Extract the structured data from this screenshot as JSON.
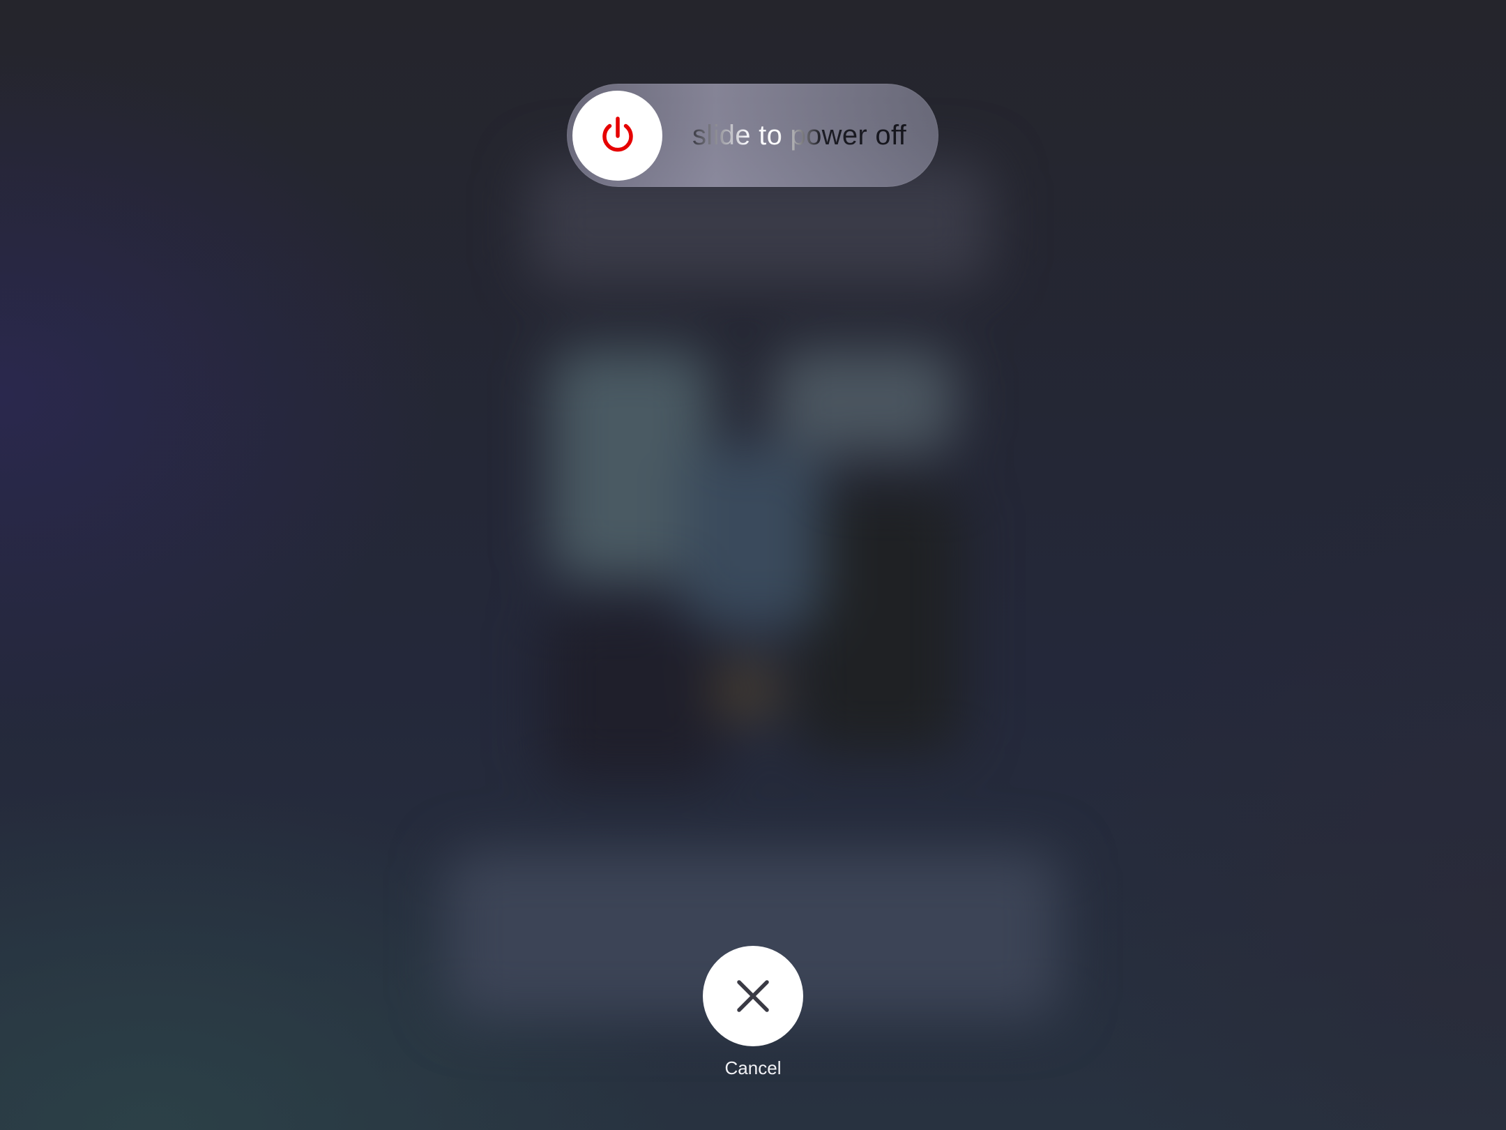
{
  "slider": {
    "label": "slide to power off",
    "knob_icon": "power-icon",
    "icon_color": "#e60000"
  },
  "cancel": {
    "label": "Cancel",
    "icon": "close-icon",
    "icon_color": "#3a3a44"
  }
}
